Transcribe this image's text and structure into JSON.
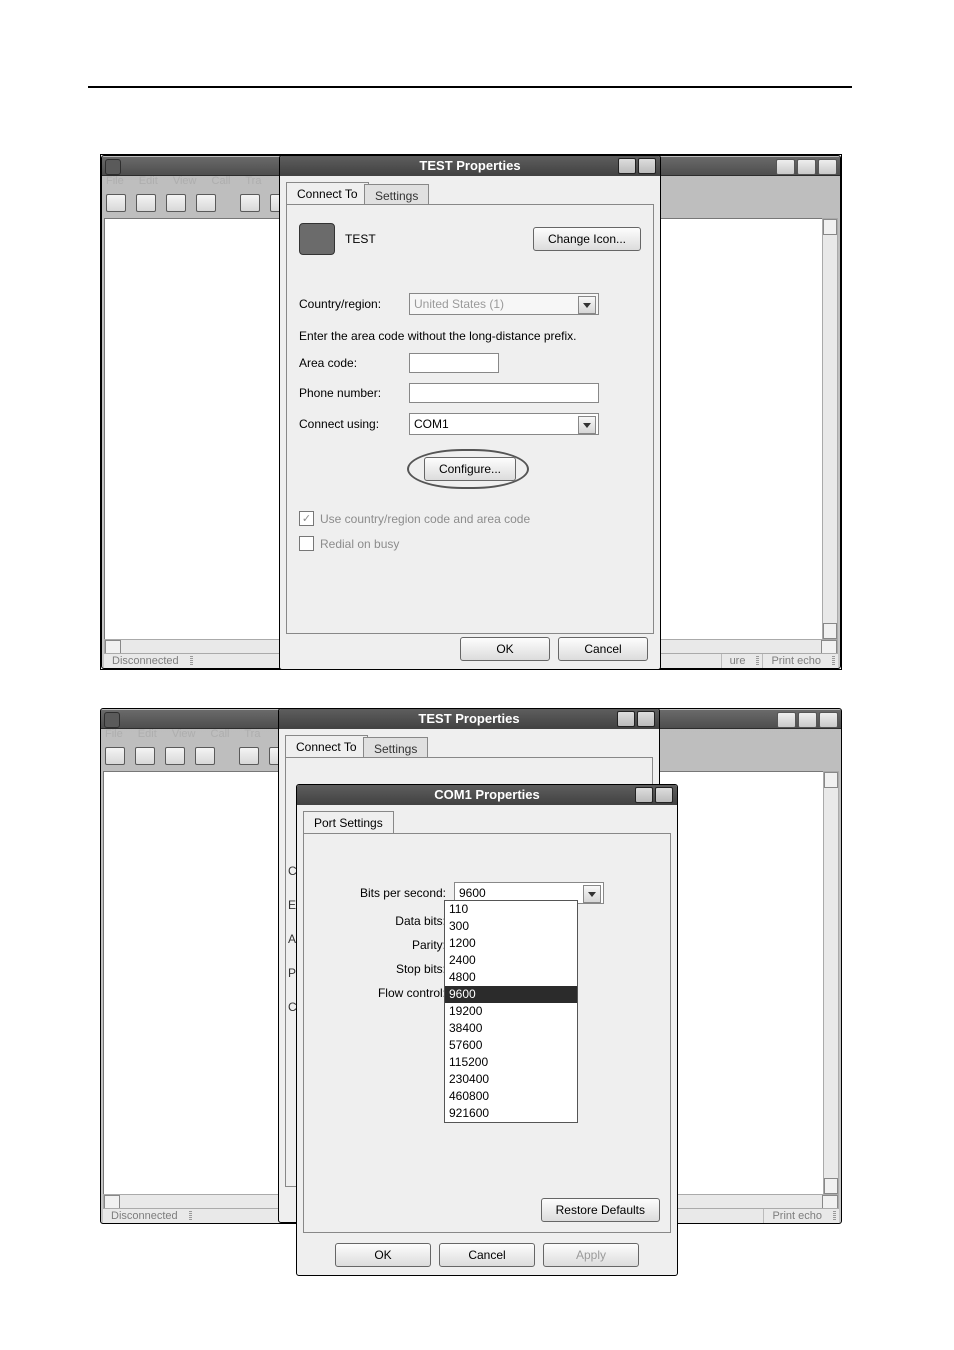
{
  "app": {
    "menus": [
      "File",
      "Edit",
      "View",
      "Call",
      "Tra"
    ],
    "status_text": "Disconnected",
    "status_right_1": "ure",
    "status_right_2": "Print echo",
    "win_title_suffix": "TEST Properties"
  },
  "dlg1": {
    "title": "TEST Properties",
    "tabs": {
      "connect": "Connect To",
      "settings": "Settings"
    },
    "conn_name": "TEST",
    "change_icon": "Change Icon...",
    "lbl_country": "Country/region:",
    "country_value": "United States (1)",
    "hint": "Enter the area code without the long-distance prefix.",
    "lbl_area": "Area code:",
    "lbl_phone": "Phone number:",
    "lbl_using": "Connect using:",
    "using_value": "COM1",
    "configure": "Configure...",
    "chk_country": "Use country/region code and area code",
    "chk_redial": "Redial on busy",
    "ok": "OK",
    "cancel": "Cancel"
  },
  "dlg2": {
    "outer_title": "TEST Properties",
    "outer_tabs": {
      "connect": "Connect To",
      "settings": "Settings"
    },
    "inner_title": "COM1 Properties",
    "inner_tab": "Port Settings",
    "lbl_bps": "Bits per second:",
    "bps_value": "9600",
    "bps_options": [
      "110",
      "300",
      "1200",
      "2400",
      "4800",
      "9600",
      "19200",
      "38400",
      "57600",
      "115200",
      "230400",
      "460800",
      "921600"
    ],
    "bps_selected_index": 5,
    "lbl_databits": "Data bits:",
    "lbl_parity": "Parity:",
    "lbl_stopbits": "Stop bits:",
    "lbl_flow": "Flow control:",
    "restore": "Restore Defaults",
    "ok": "OK",
    "cancel": "Cancel",
    "apply": "Apply",
    "left_hints": [
      "C",
      "E",
      "A",
      "P",
      "C"
    ]
  }
}
